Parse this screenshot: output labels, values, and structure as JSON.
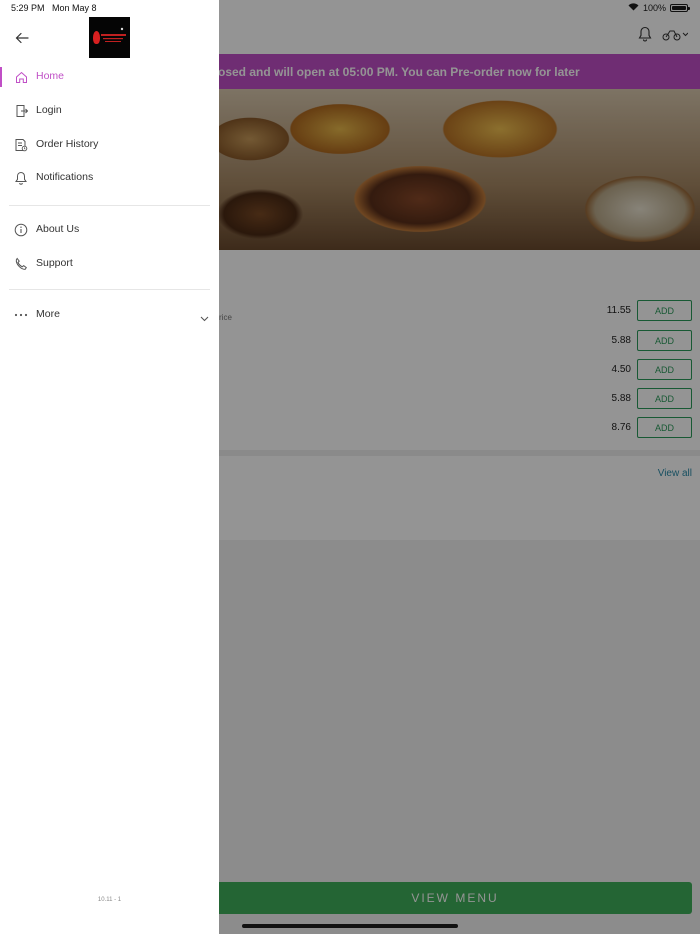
{
  "status_bar": {
    "time": "5:29 PM",
    "date": "Mon May 8",
    "battery_text": "100%",
    "battery_level": 1.0
  },
  "app": {
    "banner_text": "osed and will open at 05:00 PM. You can Pre-order now for later",
    "menu_items": [
      {
        "price": "11.55",
        "add_label": "ADD"
      },
      {
        "price": "5.88",
        "add_label": "ADD"
      },
      {
        "price": "4.50",
        "add_label": "ADD"
      },
      {
        "price": "5.88",
        "add_label": "ADD"
      },
      {
        "price": "8.76",
        "add_label": "ADD"
      }
    ],
    "menu_note": "rice",
    "view_all": "View all",
    "view_menu": "VIEW MENU"
  },
  "drawer": {
    "items": [
      {
        "label": "Home",
        "icon": "home-icon",
        "active": true
      },
      {
        "label": "Login",
        "icon": "login-icon",
        "active": false
      },
      {
        "label": "Order History",
        "icon": "order-history-icon",
        "active": false
      },
      {
        "label": "Notifications",
        "icon": "bell-icon",
        "active": false
      }
    ],
    "items2": [
      {
        "label": "About Us",
        "icon": "info-icon"
      },
      {
        "label": "Support",
        "icon": "phone-icon"
      }
    ],
    "more_label": "More",
    "version": "10.11 - 1"
  },
  "colors": {
    "accent": "#c04fc6",
    "add_green": "#2a9a5a",
    "view_menu_green": "#3fae5a"
  }
}
